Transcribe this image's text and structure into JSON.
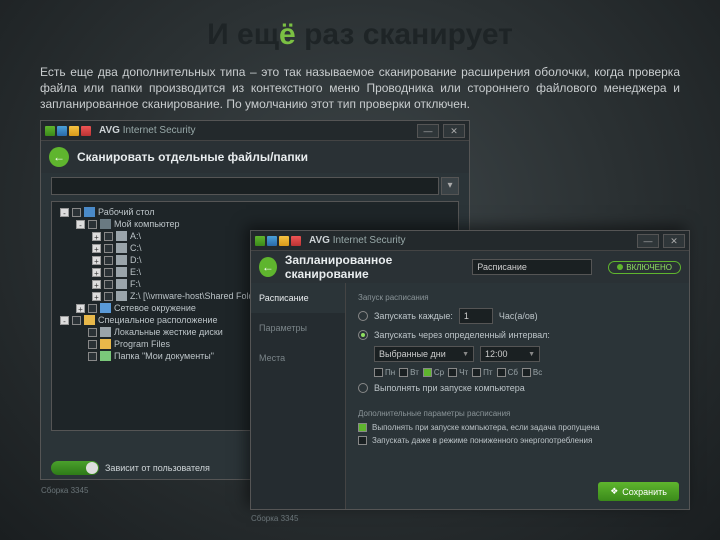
{
  "slide": {
    "title_pre": "И ещ",
    "title_accent": "ё",
    "title_post": " раз сканирует",
    "body": "Есть еще два дополнительных типа – это так называемое сканирование расширения оболочки, когда проверка файла или папки производится из контекстного меню Проводника или стороннего файлового менеджера и запланированное сканирование. По умолчанию этот тип проверки отключен."
  },
  "win1": {
    "brand": "AVG",
    "product": "Internet Security",
    "subtitle": "Сканировать отдельные файлы/папки",
    "search_placeholder": "",
    "tree": [
      {
        "level": 1,
        "expand": "-",
        "icon": "desktop",
        "label": "Рабочий стол"
      },
      {
        "level": 2,
        "expand": "-",
        "icon": "computer",
        "label": "Мой компьютер"
      },
      {
        "level": 3,
        "expand": "+",
        "icon": "drive",
        "label": "A:\\"
      },
      {
        "level": 3,
        "expand": "+",
        "icon": "drive",
        "label": "C:\\"
      },
      {
        "level": 3,
        "expand": "+",
        "icon": "drive",
        "label": "D:\\"
      },
      {
        "level": 3,
        "expand": "+",
        "icon": "drive",
        "label": "E:\\"
      },
      {
        "level": 3,
        "expand": "+",
        "icon": "drive",
        "label": "F:\\"
      },
      {
        "level": 3,
        "expand": "+",
        "icon": "drive",
        "label": "Z:\\ [\\\\vmware-host\\Shared Folders\\]"
      },
      {
        "level": 2,
        "expand": "+",
        "icon": "network",
        "label": "Сетевое окружение"
      },
      {
        "level": 1,
        "expand": "-",
        "icon": "folder",
        "label": "Специальное расположение"
      },
      {
        "level": 2,
        "expand": " ",
        "icon": "drive",
        "label": "Локальные жесткие диски"
      },
      {
        "level": 2,
        "expand": " ",
        "icon": "folder",
        "label": "Program Files"
      },
      {
        "level": 2,
        "expand": " ",
        "icon": "docs",
        "label": "Папка \"Мои документы\""
      }
    ],
    "footer_label": "Зависит от пользователя",
    "status": "Сборка 3345"
  },
  "win2": {
    "brand": "AVG",
    "product": "Internet Security",
    "subtitle": "Запланированное сканирование",
    "schedule_name": "Расписание",
    "enabled": "ВКЛЮЧЕНО",
    "tabs": [
      "Расписание",
      "Параметры",
      "Места"
    ],
    "section": "Запуск расписания",
    "opt_every": "Запускать каждые:",
    "every_value": "1",
    "every_unit": "Час(а/ов)",
    "opt_interval": "Запускать через определенный интервал:",
    "interval_sel": "Выбранные дни",
    "time_value": "12:00",
    "days": [
      "Пн",
      "Вт",
      "Ср",
      "Чт",
      "Пт",
      "Сб",
      "Вс"
    ],
    "days_checked": [
      false,
      false,
      true,
      false,
      false,
      false,
      false
    ],
    "opt_boot": "Выполнять при запуске компьютера",
    "adv_section": "Дополнительные параметры расписания",
    "adv1": "Выполнять при запуске компьютера, если задача пропущена",
    "adv2": "Запускать даже в режиме пониженного энергопотребления",
    "save": "Сохранить",
    "status": "Сборка 3345"
  }
}
